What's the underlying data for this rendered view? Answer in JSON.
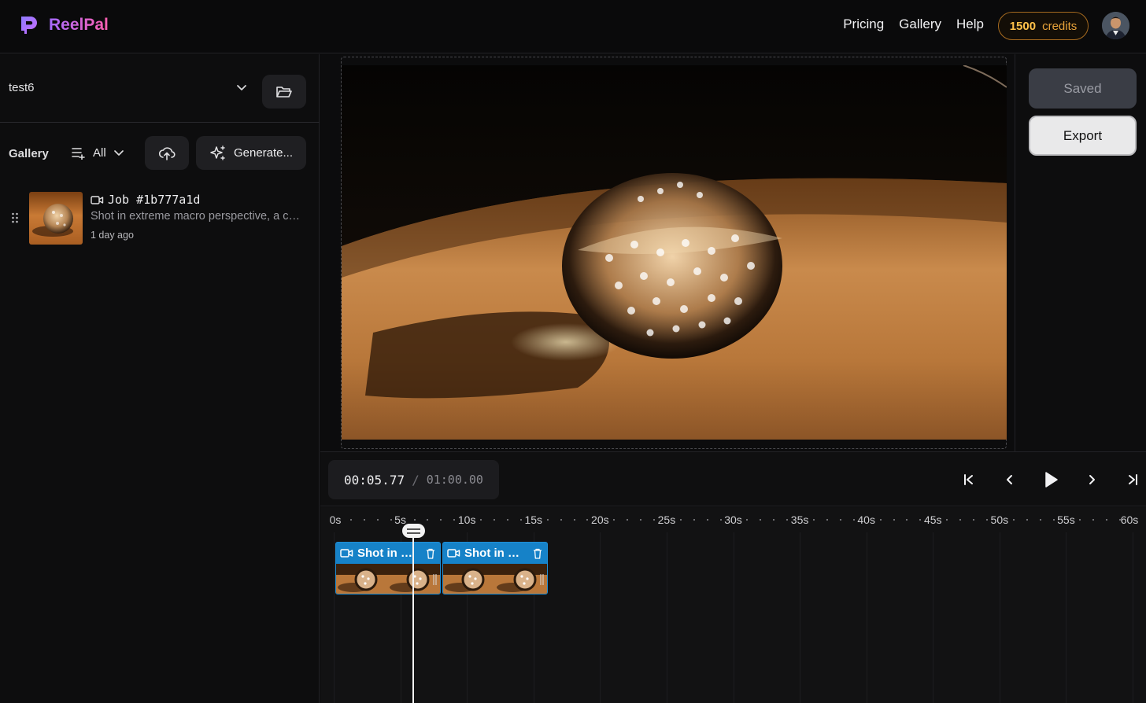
{
  "app": {
    "name": "ReelPal"
  },
  "nav": {
    "pricing": "Pricing",
    "gallery": "Gallery",
    "help": "Help"
  },
  "credits": {
    "amount": "1500",
    "label": "credits"
  },
  "project": {
    "name": "test6"
  },
  "gallery": {
    "label": "Gallery",
    "filter": "All",
    "generate_label": "Generate...",
    "items": [
      {
        "title": "Job #1b777a1d",
        "description": "Shot in extreme macro perspective, a crystal-clear glass sphere rests on a wooden surface",
        "time": "1 day ago"
      }
    ]
  },
  "actions": {
    "saved": "Saved",
    "export": "Export"
  },
  "player": {
    "current_time": "00:05.77",
    "separator": "/",
    "duration": "01:00.00"
  },
  "timeline": {
    "ticks": [
      "0s",
      "5s",
      "10s",
      "15s",
      "20s",
      "25s",
      "30s",
      "35s",
      "40s",
      "45s",
      "50s",
      "55s",
      "60s"
    ],
    "playhead_seconds": 5.77,
    "clips": [
      {
        "label": "Shot in extreme macro perspective",
        "start_seconds": 0,
        "end_seconds": 7.8
      },
      {
        "label": "Shot in extreme macro perspective",
        "start_seconds": 7.9,
        "end_seconds": 15.7
      }
    ]
  },
  "colors": {
    "brand_start": "#a56bff",
    "brand_end": "#ff5fb0",
    "clip": "#1682c8",
    "credits": "#e8a33a"
  },
  "icons": {
    "logo": "reelpal-logo-icon",
    "project_dropdown": "chevron-down-icon",
    "folder": "folder-open-icon",
    "filter": "list-filter-icon",
    "upload": "cloud-upload-icon",
    "generate": "sparkles-icon",
    "job": "video-camera-icon",
    "trash": "trash-icon"
  }
}
